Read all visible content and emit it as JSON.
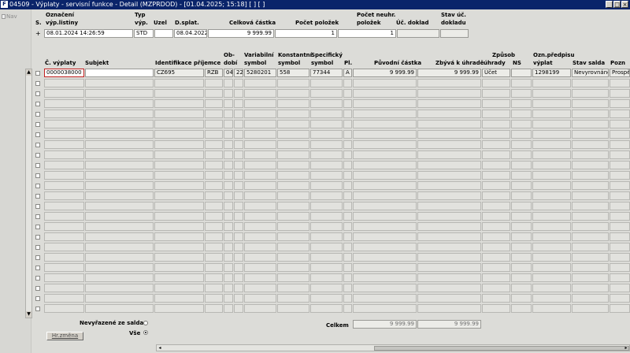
{
  "window": {
    "title": "04509 - Výplaty - servisní funkce - Detail (MZPRDOD) - [01.04.2025; 15:18]  [ ]  [ ]",
    "icon_letter": "F",
    "buttons": [
      "_",
      "□",
      "×"
    ]
  },
  "nav": {
    "label": "Nav"
  },
  "header_section": {
    "labels": {
      "s": "S.",
      "oznaceni_1": "Označení",
      "oznaceni_2": "výp.listiny",
      "typ_1": "Typ",
      "typ_2": "výp.",
      "uzel": "Uzel",
      "dsplat": "D.splat.",
      "celkova": "Celková částka",
      "pocet": "Počet položek",
      "neuhr_1": "Počet neuhr.",
      "neuhr_2": "položek",
      "uc_doklad": "Úč. doklad",
      "stav_1": "Stav úč.",
      "stav_2": "dokladu"
    },
    "row": {
      "plus": "+",
      "oznaceni": "08.01.2024 14:26:59",
      "typ": "STD",
      "uzel": "",
      "dsplat": "08.04.2022",
      "celkova": "9 999.99",
      "pocet": "1",
      "neuhr": "1",
      "uc_doklad": "",
      "stav": ""
    }
  },
  "table": {
    "headers": {
      "c_vyplaty": "Č. výplaty",
      "subjekt": "Subjekt",
      "identifikace": "Identifikace příjemce",
      "obdobi_1": "Ob-",
      "obdobi_2": "dobí",
      "variabilni_1": "Variabilní",
      "variabilni_2": "symbol",
      "konstantni_1": "Konstantní",
      "konstantni_2": "symbol",
      "specificky_1": "Specifický",
      "specificky_2": "symbol",
      "pl": "Pl.",
      "puvodni": "Původní částka",
      "zbyva": "Zbývá k úhradě",
      "zpusob_1": "Způsob",
      "zpusob_2": "úhrady",
      "ns": "NS",
      "ozn_1": "Ozn.předpisu",
      "ozn_2": "výplat",
      "stav_salda": "Stav salda",
      "pozn": "Pozn"
    },
    "rows": [
      {
        "c_vyplaty": "0000038000",
        "subjekt": "",
        "ident_country": "CZ695",
        "ident_type": "RZB",
        "obdobi_m": "04",
        "obdobi_y": "22",
        "variabilni": "5280201",
        "konstantni": "558",
        "specificky": "77344",
        "pl": "A",
        "puvodni": "9 999.99",
        "zbyva": "9 999.99",
        "zpusob": "Účet",
        "ns": "",
        "ozn": "1298199",
        "stav_salda": "Nevyrovnáno",
        "pozn": "Prospěch"
      }
    ],
    "empty_rows": 23
  },
  "footer": {
    "nevyrazene": "Nevyřazené ze salda",
    "vse": "Vše",
    "celkem": "Celkem",
    "celkem_puvodni": "9 999.99",
    "celkem_zbyva": "9 999.99",
    "hr_zmena": "Hr.změna",
    "selected_filter": "vse"
  }
}
